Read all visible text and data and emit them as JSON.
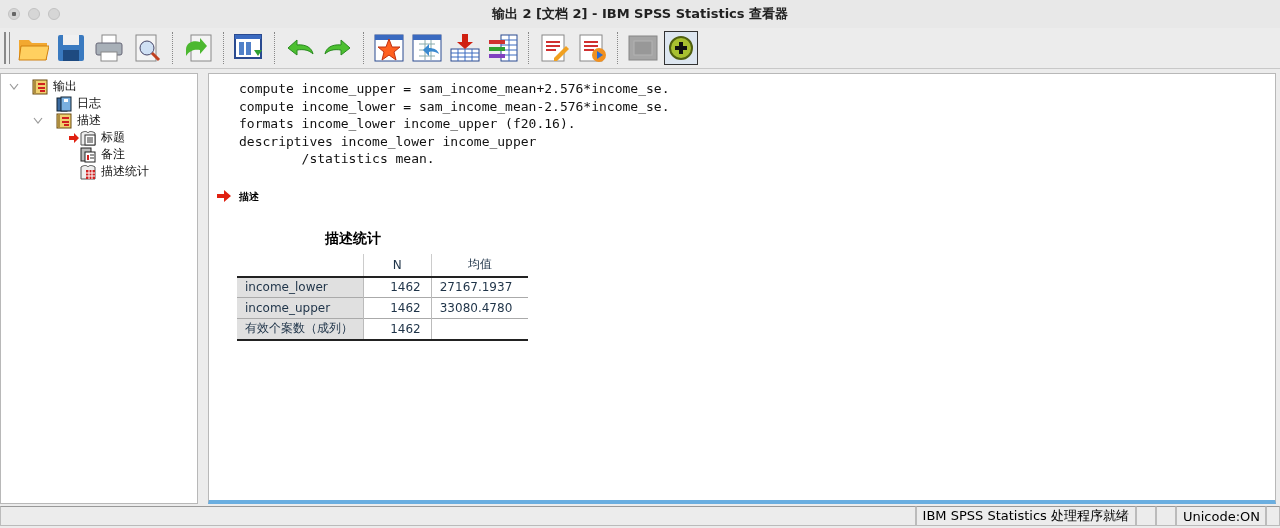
{
  "window": {
    "title": "输出 2 [文档 2] - IBM SPSS Statistics 查看器"
  },
  "toolbar": [
    [
      {
        "kind": "open"
      },
      {
        "kind": "save"
      },
      {
        "kind": "print"
      },
      {
        "kind": "preview"
      }
    ],
    [
      {
        "kind": "export"
      }
    ],
    [
      {
        "kind": "goto"
      }
    ],
    [
      {
        "kind": "undo"
      },
      {
        "kind": "redo"
      }
    ],
    [
      {
        "kind": "star"
      },
      {
        "kind": "table-back"
      },
      {
        "kind": "insert"
      },
      {
        "kind": "variables"
      }
    ],
    [
      {
        "kind": "doc-edit"
      },
      {
        "kind": "doc-play"
      }
    ],
    [
      {
        "kind": "grey",
        "disabled": true,
        "pressed": false
      },
      {
        "kind": "plus",
        "disabled": false,
        "pressed": true
      }
    ]
  ],
  "tree": [
    {
      "label": "输出",
      "kind": "output",
      "expanded": true,
      "current": false,
      "children": [
        {
          "label": "日志",
          "kind": "log",
          "current": false
        },
        {
          "label": "描述",
          "kind": "output",
          "expanded": true,
          "current": false,
          "children": [
            {
              "label": "标题",
              "kind": "title",
              "current": true
            },
            {
              "label": "备注",
              "kind": "note",
              "current": false
            },
            {
              "label": "描述统计",
              "kind": "table",
              "current": false
            }
          ]
        }
      ]
    }
  ],
  "syntax": [
    "compute income_upper = sam_income_mean+2.576*income_se.",
    "compute income_lower = sam_income_mean-2.576*income_se.",
    "formats income_lower income_upper (f20.16).",
    "descriptives income_lower income_upper",
    "        /statistics mean."
  ],
  "heading": {
    "text": "描述",
    "current": true
  },
  "table": {
    "title": "描述统计",
    "columns": [
      "N",
      "均值"
    ],
    "rows": [
      {
        "label": "income_lower",
        "cells": [
          "1462",
          "27167.1937"
        ]
      },
      {
        "label": "income_upper",
        "cells": [
          "1462",
          "33080.4780"
        ]
      },
      {
        "label": "有效个案数（成列）",
        "cells": [
          "1462"
        ]
      }
    ]
  },
  "status_bar": {
    "message": "IBM SPSS Statistics 处理程序就绪",
    "encoding": "Unicode:ON"
  }
}
